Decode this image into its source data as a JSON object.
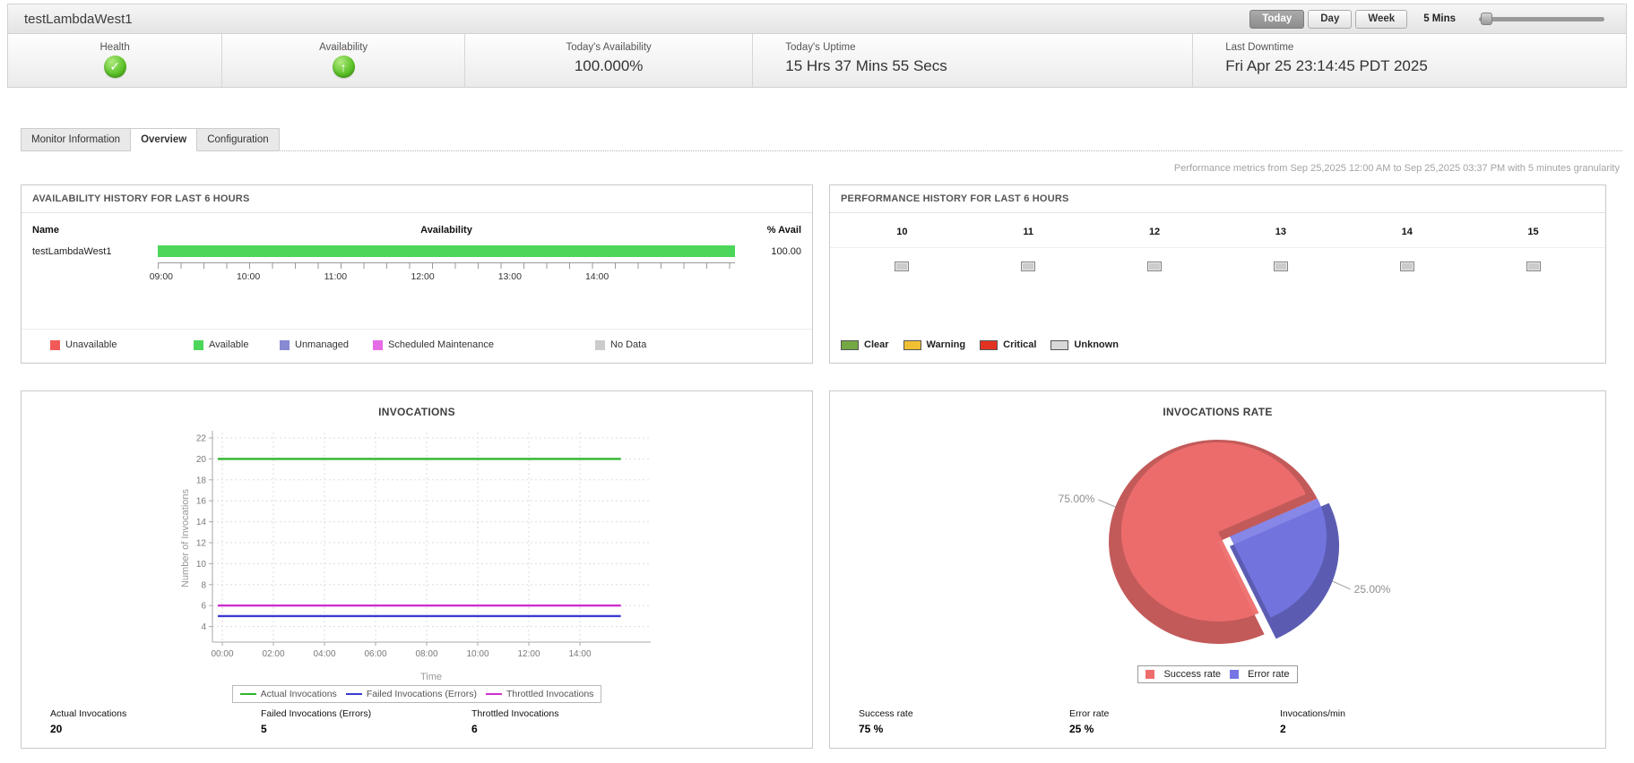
{
  "header": {
    "title": "testLambdaWest1",
    "range_buttons": [
      "Today",
      "Day",
      "Week"
    ],
    "active_range": "Today",
    "granularity_label": "5 Mins"
  },
  "status_bar": {
    "cells": [
      {
        "label": "Health",
        "icon": "check"
      },
      {
        "label": "Availability",
        "icon": "up-arrow"
      },
      {
        "label": "Today's Availability",
        "value": "100.000%"
      },
      {
        "label": "Today's Uptime",
        "value": "15 Hrs 37 Mins 55 Secs"
      },
      {
        "label": "Last Downtime",
        "value": "Fri Apr 25 23:14:45 PDT 2025"
      }
    ]
  },
  "tabs": [
    {
      "label": "Monitor Information",
      "active": false
    },
    {
      "label": "Overview",
      "active": true
    },
    {
      "label": "Configuration",
      "active": false
    }
  ],
  "metrics_note": "Performance metrics from Sep 25,2025 12:00 AM to Sep 25,2025 03:37 PM with 5 minutes granularity",
  "availability_history": {
    "title": "AVAILABILITY HISTORY FOR LAST 6 HOURS",
    "columns": [
      "Name",
      "Availability",
      "% Avail"
    ],
    "row": {
      "name": "testLambdaWest1",
      "percent_label": "100.00",
      "bar_color": "#4cd65a",
      "bar_fill_percent": 100
    },
    "axis_ticks": [
      "09:00",
      "10:00",
      "11:00",
      "12:00",
      "13:00",
      "14:00"
    ],
    "legend": [
      {
        "label": "Unavailable",
        "color": "#f25a5a"
      },
      {
        "label": "Available",
        "color": "#4cd65a"
      },
      {
        "label": "Unmanaged",
        "color": "#8789d3"
      },
      {
        "label": "Scheduled Maintenance",
        "color": "#e66ce6"
      },
      {
        "label": "No Data",
        "color": "#cccccc"
      }
    ]
  },
  "performance_history": {
    "title": "PERFORMANCE HISTORY FOR LAST 6 HOURS",
    "hours": [
      "10",
      "11",
      "12",
      "13",
      "14",
      "15"
    ],
    "statuses": [
      "unknown",
      "unknown",
      "unknown",
      "unknown",
      "unknown",
      "unknown"
    ],
    "status_colors": {
      "clear": "#74a843",
      "warning": "#f0c033",
      "critical": "#e23222",
      "unknown": "#cccccc"
    },
    "legend": [
      {
        "label": "Clear",
        "color": "#74a843"
      },
      {
        "label": "Warning",
        "color": "#f0c033"
      },
      {
        "label": "Critical",
        "color": "#e23222"
      },
      {
        "label": "Unknown",
        "color": "#d8d8d8"
      }
    ]
  },
  "chart_data": [
    {
      "type": "line",
      "title": "INVOCATIONS",
      "xlabel": "Time",
      "ylabel": "Number of Invocations",
      "x_ticks": [
        "00:00",
        "02:00",
        "04:00",
        "06:00",
        "08:00",
        "10:00",
        "12:00",
        "14:00"
      ],
      "x_range_hours": [
        0,
        15.6
      ],
      "y_ticks": [
        4,
        6,
        8,
        10,
        12,
        14,
        16,
        18,
        20,
        22
      ],
      "ylim": [
        3,
        23
      ],
      "grid": true,
      "legend_position": "bottom",
      "series": [
        {
          "name": "Actual Invocations",
          "color": "#2fb52f",
          "value": 20
        },
        {
          "name": "Failed Invocations (Errors)",
          "color": "#3b3bd1",
          "value": 5
        },
        {
          "name": "Throttled Invocations",
          "color": "#cf2fcf",
          "value": 6
        }
      ]
    },
    {
      "type": "pie",
      "title": "INVOCATIONS RATE",
      "legend_position": "bottom",
      "slices": [
        {
          "label": "Success rate",
          "value": 75,
          "display": "75.00%",
          "color": "#ee6e6e"
        },
        {
          "label": "Error rate",
          "value": 25,
          "display": "25.00%",
          "color": "#7576e3"
        }
      ]
    }
  ],
  "invocations_stats": [
    {
      "label": "Actual Invocations",
      "value": "20"
    },
    {
      "label": "Failed Invocations (Errors)",
      "value": "5"
    },
    {
      "label": "Throttled Invocations",
      "value": "6"
    }
  ],
  "rate_stats": [
    {
      "label": "Success rate",
      "value": "75 %"
    },
    {
      "label": "Error rate",
      "value": "25 %"
    },
    {
      "label": "Invocations/min",
      "value": "2"
    }
  ]
}
